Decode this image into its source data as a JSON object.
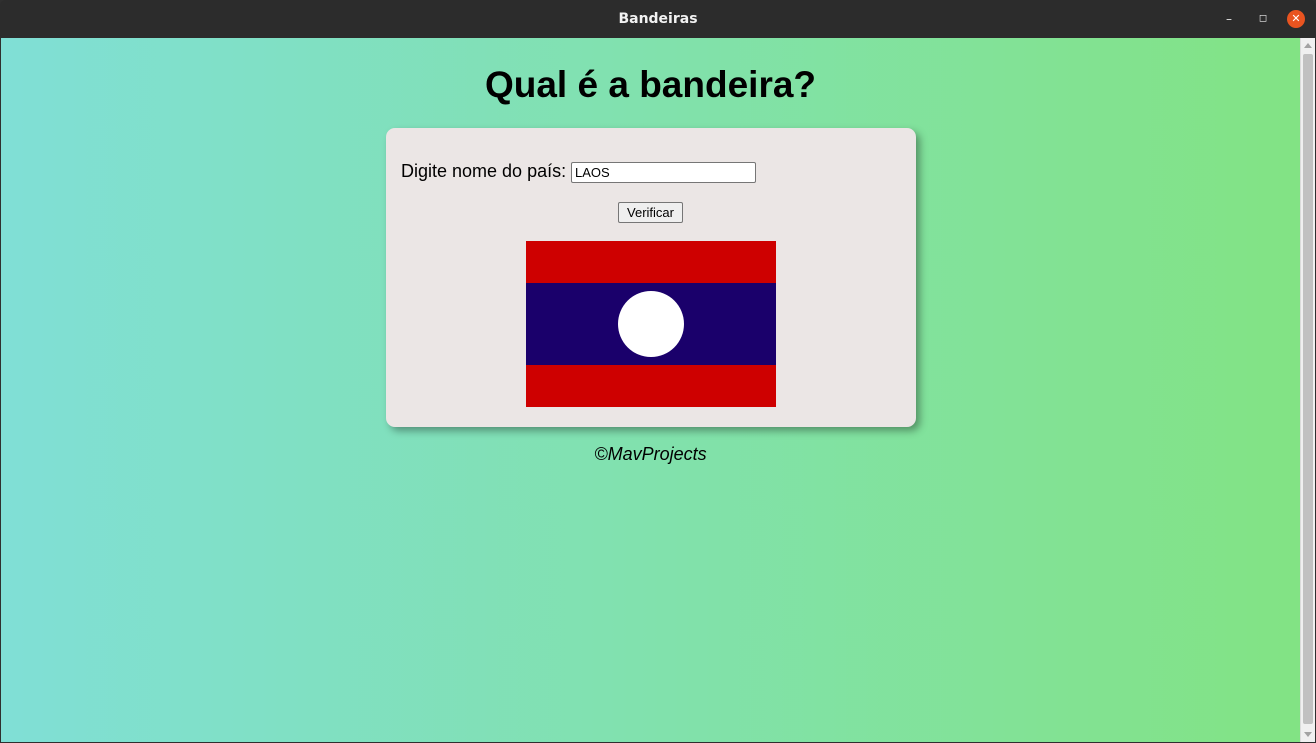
{
  "window": {
    "title": "Bandeiras",
    "controls": {
      "minimize_glyph": "–",
      "maximize_glyph": "◻",
      "close_glyph": "✕"
    }
  },
  "page": {
    "heading": "Qual é a bandeira?",
    "form": {
      "label": "Digite nome do país:",
      "input_value": "LAOS",
      "button_label": "Verificar"
    },
    "flag": {
      "country": "Laos",
      "colors": {
        "red": "#ce0000",
        "blue": "#1a006b",
        "circle": "#ffffff"
      }
    },
    "footer": "©MavProjects"
  },
  "colors": {
    "gradient_start": "#80dfd6",
    "gradient_end": "#82e384",
    "card_bg": "#ebe6e5",
    "close_button": "#e95420"
  }
}
